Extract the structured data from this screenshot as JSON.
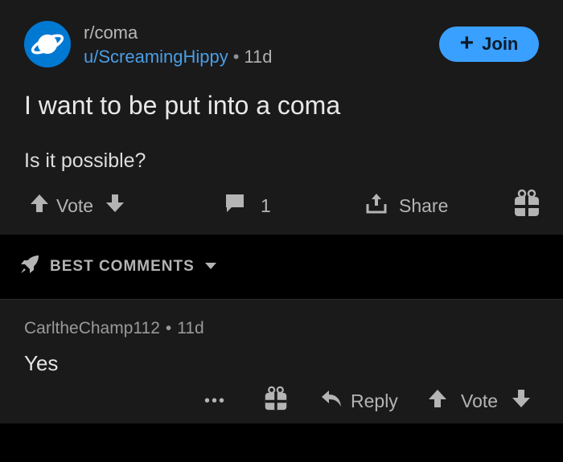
{
  "post": {
    "subreddit": "r/coma",
    "author": "u/ScreamingHippy",
    "separator": "•",
    "age": "11d",
    "join_label": "Join",
    "join_plus": "+",
    "title": "I want to be put into a coma",
    "body": "Is it possible?",
    "vote_label": "Vote",
    "comment_count": "1",
    "share_label": "Share"
  },
  "sort": {
    "label": "BEST COMMENTS"
  },
  "comment": {
    "author": "CarltheChamp112",
    "separator": "•",
    "age": "11d",
    "text": "Yes",
    "more_label": "•••",
    "reply_label": "Reply",
    "vote_label": "Vote"
  },
  "colors": {
    "background": "#000000",
    "card": "#1a1a1b",
    "accent": "#3aa0ff",
    "username": "#4a9ee6",
    "text_muted": "#b4b4b4"
  },
  "icons": {
    "subreddit_avatar": "planet-icon",
    "upvote": "arrow-up-icon",
    "downvote": "arrow-down-icon",
    "comments": "comment-bubble-icon",
    "share": "share-icon",
    "award": "gift-icon",
    "sort": "rocket-icon",
    "sort_chevron": "chevron-down-icon",
    "reply": "reply-arrow-icon"
  }
}
